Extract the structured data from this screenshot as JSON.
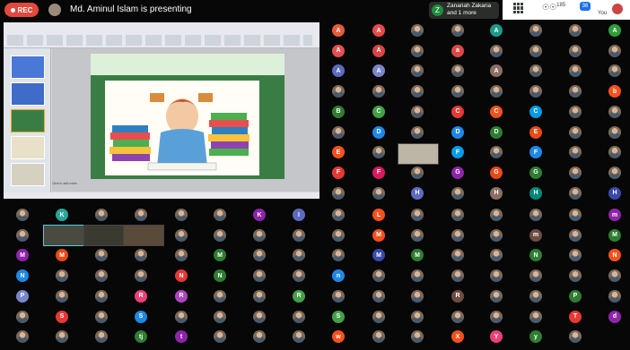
{
  "meeting": {
    "rec_label": "REC",
    "presenting_text": "Md. Aminul Islam is presenting",
    "speaker_initial": "Z",
    "speaker_line1": "Zanariah Zakaria",
    "speaker_line2": "and 1 more",
    "people_count": "185",
    "chat_count": "36",
    "you_label": "You"
  },
  "slides": {
    "notes_placeholder": "Click to add notes"
  },
  "participants": [
    {
      "row": 0,
      "col": 0,
      "initial": "A",
      "color": "#e85a3c"
    },
    {
      "row": 0,
      "col": 1,
      "initial": "A",
      "color": "#e64a4a"
    },
    {
      "row": 0,
      "col": 2,
      "initial": "",
      "color": "photo"
    },
    {
      "row": 0,
      "col": 3,
      "initial": "",
      "color": "photo"
    },
    {
      "row": 0,
      "col": 4,
      "initial": "A",
      "color": "#1b9a8a"
    },
    {
      "row": 0,
      "col": 5,
      "initial": "",
      "color": "photo"
    },
    {
      "row": 0,
      "col": 6,
      "initial": "",
      "color": "photo"
    },
    {
      "row": 0,
      "col": 7,
      "initial": "A",
      "color": "#2e9e3a"
    },
    {
      "row": 1,
      "col": 0,
      "initial": "A",
      "color": "#e05050"
    },
    {
      "row": 1,
      "col": 1,
      "initial": "A",
      "color": "#d84545"
    },
    {
      "row": 1,
      "col": 2,
      "initial": "",
      "color": "photo"
    },
    {
      "row": 1,
      "col": 3,
      "initial": "a",
      "color": "#d84a4a"
    },
    {
      "row": 1,
      "col": 4,
      "initial": "",
      "color": "photo"
    },
    {
      "row": 1,
      "col": 5,
      "initial": "",
      "color": "photo"
    },
    {
      "row": 1,
      "col": 6,
      "initial": "",
      "color": "photo"
    },
    {
      "row": 1,
      "col": 7,
      "initial": "",
      "color": "photo"
    },
    {
      "row": 2,
      "col": 0,
      "initial": "A",
      "color": "#5c6bc0"
    },
    {
      "row": 2,
      "col": 1,
      "initial": "A",
      "color": "#7986cb"
    },
    {
      "row": 2,
      "col": 2,
      "initial": "",
      "color": "photo"
    },
    {
      "row": 2,
      "col": 3,
      "initial": "",
      "color": "photo"
    },
    {
      "row": 2,
      "col": 4,
      "initial": "A",
      "color": "#8d6e63"
    },
    {
      "row": 2,
      "col": 5,
      "initial": "",
      "color": "photo"
    },
    {
      "row": 2,
      "col": 6,
      "initial": "",
      "color": "photo"
    },
    {
      "row": 2,
      "col": 7,
      "initial": "",
      "color": "photo"
    },
    {
      "row": 3,
      "col": 0,
      "initial": "",
      "color": "photo"
    },
    {
      "row": 3,
      "col": 1,
      "initial": "",
      "color": "photo"
    },
    {
      "row": 3,
      "col": 2,
      "initial": "",
      "color": "photo"
    },
    {
      "row": 3,
      "col": 3,
      "initial": "",
      "color": "photo"
    },
    {
      "row": 3,
      "col": 4,
      "initial": "",
      "color": "photo"
    },
    {
      "row": 3,
      "col": 5,
      "initial": "",
      "color": "photo"
    },
    {
      "row": 3,
      "col": 6,
      "initial": "",
      "color": "photo"
    },
    {
      "row": 3,
      "col": 7,
      "initial": "b",
      "color": "#f4511e"
    },
    {
      "row": 4,
      "col": 0,
      "initial": "B",
      "color": "#2e7d32"
    },
    {
      "row": 4,
      "col": 1,
      "initial": "C",
      "color": "#43a047"
    },
    {
      "row": 4,
      "col": 2,
      "initial": "",
      "color": "photo"
    },
    {
      "row": 4,
      "col": 3,
      "initial": "C",
      "color": "#e53935"
    },
    {
      "row": 4,
      "col": 4,
      "initial": "C",
      "color": "#f4511e"
    },
    {
      "row": 4,
      "col": 5,
      "initial": "C",
      "color": "#039be5"
    },
    {
      "row": 4,
      "col": 6,
      "initial": "",
      "color": "photo"
    },
    {
      "row": 4,
      "col": 7,
      "initial": "",
      "color": "photo"
    },
    {
      "row": 5,
      "col": 0,
      "initial": "",
      "color": "photo"
    },
    {
      "row": 5,
      "col": 1,
      "initial": "D",
      "color": "#1e88e5"
    },
    {
      "row": 5,
      "col": 2,
      "initial": "",
      "color": "photo"
    },
    {
      "row": 5,
      "col": 3,
      "initial": "D",
      "color": "#1e88e5"
    },
    {
      "row": 5,
      "col": 4,
      "initial": "D",
      "color": "#2e7d32"
    },
    {
      "row": 5,
      "col": 5,
      "initial": "E",
      "color": "#e64a19"
    },
    {
      "row": 5,
      "col": 6,
      "initial": "",
      "color": "photo"
    },
    {
      "row": 5,
      "col": 7,
      "initial": "",
      "color": "photo"
    },
    {
      "row": 6,
      "col": 0,
      "initial": "E",
      "color": "#f4511e"
    },
    {
      "row": 6,
      "col": 1,
      "initial": "",
      "color": "photo"
    },
    {
      "row": 6,
      "col": 3,
      "initial": "F",
      "color": "#039be5"
    },
    {
      "row": 6,
      "col": 4,
      "initial": "",
      "color": "photo"
    },
    {
      "row": 6,
      "col": 5,
      "initial": "F",
      "color": "#1e88e5"
    },
    {
      "row": 6,
      "col": 6,
      "initial": "",
      "color": "photo"
    },
    {
      "row": 6,
      "col": 7,
      "initial": "",
      "color": "photo"
    },
    {
      "row": 7,
      "col": 0,
      "initial": "F",
      "color": "#e53935"
    },
    {
      "row": 7,
      "col": 1,
      "initial": "F",
      "color": "#d81b60"
    },
    {
      "row": 7,
      "col": 2,
      "initial": "",
      "color": "photo"
    },
    {
      "row": 7,
      "col": 3,
      "initial": "G",
      "color": "#8e24aa"
    },
    {
      "row": 7,
      "col": 4,
      "initial": "G",
      "color": "#e64a19"
    },
    {
      "row": 7,
      "col": 5,
      "initial": "G",
      "color": "#2e7d32"
    },
    {
      "row": 7,
      "col": 6,
      "initial": "",
      "color": "photo"
    },
    {
      "row": 7,
      "col": 7,
      "initial": "",
      "color": "photo"
    },
    {
      "row": 8,
      "col": 0,
      "initial": "",
      "color": "photo"
    },
    {
      "row": 8,
      "col": 1,
      "initial": "",
      "color": "photo"
    },
    {
      "row": 8,
      "col": 2,
      "initial": "H",
      "color": "#5c6bc0"
    },
    {
      "row": 8,
      "col": 3,
      "initial": "",
      "color": "photo"
    },
    {
      "row": 8,
      "col": 4,
      "initial": "H",
      "color": "#8d6e63"
    },
    {
      "row": 8,
      "col": 5,
      "initial": "H",
      "color": "#00897b"
    },
    {
      "row": 8,
      "col": 6,
      "initial": "",
      "color": "photo"
    },
    {
      "row": 8,
      "col": 7,
      "initial": "H",
      "color": "#3949ab"
    },
    {
      "row": 9,
      "col": 0,
      "initial": "",
      "color": "photo"
    },
    {
      "row": 9,
      "col": 1,
      "initial": "K",
      "color": "#26a69a"
    },
    {
      "row": 9,
      "col": 2,
      "initial": "",
      "color": "photo"
    },
    {
      "row": 9,
      "col": 3,
      "initial": "",
      "color": "photo"
    },
    {
      "row": 9,
      "col": 4,
      "initial": "",
      "color": "photo"
    },
    {
      "row": 9,
      "col": 5,
      "initial": "",
      "color": "photo"
    },
    {
      "row": 9,
      "col": 6,
      "initial": "K",
      "color": "#8e24aa"
    },
    {
      "row": 9,
      "col": 7,
      "initial": "I",
      "color": "#5c6bc0"
    },
    {
      "row": 9,
      "col": 8,
      "initial": "",
      "color": "photo"
    },
    {
      "row": 9,
      "col": 9,
      "initial": "L",
      "color": "#f4511e"
    },
    {
      "row": 9,
      "col": 10,
      "initial": "",
      "color": "photo"
    },
    {
      "row": 9,
      "col": 11,
      "initial": "",
      "color": "photo"
    },
    {
      "row": 9,
      "col": 12,
      "initial": "",
      "color": "photo"
    },
    {
      "row": 9,
      "col": 13,
      "initial": "",
      "color": "photo"
    },
    {
      "row": 9,
      "col": 14,
      "initial": "",
      "color": "photo"
    },
    {
      "row": 9,
      "col": 15,
      "initial": "m",
      "color": "#8e24aa"
    },
    {
      "row": 10,
      "col": 0,
      "initial": "",
      "color": "photo"
    },
    {
      "row": 10,
      "col": 4,
      "initial": "",
      "color": "photo"
    },
    {
      "row": 10,
      "col": 5,
      "initial": "",
      "color": "photo"
    },
    {
      "row": 10,
      "col": 6,
      "initial": "",
      "color": "photo"
    },
    {
      "row": 10,
      "col": 7,
      "initial": "",
      "color": "photo"
    },
    {
      "row": 10,
      "col": 8,
      "initial": "",
      "color": "photo"
    },
    {
      "row": 10,
      "col": 9,
      "initial": "M",
      "color": "#f4511e"
    },
    {
      "row": 10,
      "col": 10,
      "initial": "",
      "color": "photo"
    },
    {
      "row": 10,
      "col": 11,
      "initial": "",
      "color": "photo"
    },
    {
      "row": 10,
      "col": 12,
      "initial": "",
      "color": "photo"
    },
    {
      "row": 10,
      "col": 13,
      "initial": "m",
      "color": "#6d4c41"
    },
    {
      "row": 10,
      "col": 14,
      "initial": "",
      "color": "photo"
    },
    {
      "row": 10,
      "col": 15,
      "initial": "M",
      "color": "#2e7d32"
    },
    {
      "row": 11,
      "col": 0,
      "initial": "M",
      "color": "#8e24aa"
    },
    {
      "row": 11,
      "col": 1,
      "initial": "M",
      "color": "#e64a19"
    },
    {
      "row": 11,
      "col": 2,
      "initial": "",
      "color": "photo"
    },
    {
      "row": 11,
      "col": 3,
      "initial": "",
      "color": "photo"
    },
    {
      "row": 11,
      "col": 4,
      "initial": "",
      "color": "photo"
    },
    {
      "row": 11,
      "col": 5,
      "initial": "M",
      "color": "#2e7d32"
    },
    {
      "row": 11,
      "col": 6,
      "initial": "",
      "color": "photo"
    },
    {
      "row": 11,
      "col": 7,
      "initial": "",
      "color": "photo"
    },
    {
      "row": 11,
      "col": 8,
      "initial": "",
      "color": "photo"
    },
    {
      "row": 11,
      "col": 9,
      "initial": "M",
      "color": "#3949ab"
    },
    {
      "row": 11,
      "col": 10,
      "initial": "M",
      "color": "#2e7d32"
    },
    {
      "row": 11,
      "col": 11,
      "initial": "",
      "color": "photo"
    },
    {
      "row": 11,
      "col": 12,
      "initial": "",
      "color": "photo"
    },
    {
      "row": 11,
      "col": 13,
      "initial": "N",
      "color": "#2e7d32"
    },
    {
      "row": 11,
      "col": 14,
      "initial": "",
      "color": "photo"
    },
    {
      "row": 11,
      "col": 15,
      "initial": "N",
      "color": "#f4511e"
    },
    {
      "row": 12,
      "col": 0,
      "initial": "N",
      "color": "#1e88e5"
    },
    {
      "row": 12,
      "col": 1,
      "initial": "",
      "color": "photo"
    },
    {
      "row": 12,
      "col": 2,
      "initial": "",
      "color": "photo"
    },
    {
      "row": 12,
      "col": 3,
      "initial": "",
      "color": "photo"
    },
    {
      "row": 12,
      "col": 4,
      "initial": "N",
      "color": "#e53935"
    },
    {
      "row": 12,
      "col": 5,
      "initial": "N",
      "color": "#2e7d32"
    },
    {
      "row": 12,
      "col": 6,
      "initial": "",
      "color": "photo"
    },
    {
      "row": 12,
      "col": 7,
      "initial": "",
      "color": "photo"
    },
    {
      "row": 12,
      "col": 8,
      "initial": "n",
      "color": "#1e88e5"
    },
    {
      "row": 12,
      "col": 9,
      "initial": "",
      "color": "photo"
    },
    {
      "row": 12,
      "col": 10,
      "initial": "",
      "color": "photo"
    },
    {
      "row": 12,
      "col": 11,
      "initial": "",
      "color": "photo"
    },
    {
      "row": 12,
      "col": 12,
      "initial": "",
      "color": "photo"
    },
    {
      "row": 12,
      "col": 13,
      "initial": "",
      "color": "photo"
    },
    {
      "row": 12,
      "col": 14,
      "initial": "",
      "color": "photo"
    },
    {
      "row": 12,
      "col": 15,
      "initial": "",
      "color": "photo"
    },
    {
      "row": 13,
      "col": 0,
      "initial": "P",
      "color": "#7986cb"
    },
    {
      "row": 13,
      "col": 1,
      "initial": "",
      "color": "photo"
    },
    {
      "row": 13,
      "col": 2,
      "initial": "",
      "color": "photo"
    },
    {
      "row": 13,
      "col": 3,
      "initial": "R",
      "color": "#ec407a"
    },
    {
      "row": 13,
      "col": 4,
      "initial": "R",
      "color": "#ab47bc"
    },
    {
      "row": 13,
      "col": 5,
      "initial": "",
      "color": "photo"
    },
    {
      "row": 13,
      "col": 6,
      "initial": "",
      "color": "photo"
    },
    {
      "row": 13,
      "col": 7,
      "initial": "R",
      "color": "#43a047"
    },
    {
      "row": 13,
      "col": 8,
      "initial": "",
      "color": "photo"
    },
    {
      "row": 13,
      "col": 9,
      "initial": "",
      "color": "photo"
    },
    {
      "row": 13,
      "col": 10,
      "initial": "",
      "color": "photo"
    },
    {
      "row": 13,
      "col": 11,
      "initial": "R",
      "color": "#6d4c41"
    },
    {
      "row": 13,
      "col": 12,
      "initial": "",
      "color": "photo"
    },
    {
      "row": 13,
      "col": 13,
      "initial": "",
      "color": "photo"
    },
    {
      "row": 13,
      "col": 14,
      "initial": "P",
      "color": "#2e7d32"
    },
    {
      "row": 13,
      "col": 15,
      "initial": "",
      "color": "photo"
    },
    {
      "row": 14,
      "col": 0,
      "initial": "",
      "color": "photo"
    },
    {
      "row": 14,
      "col": 1,
      "initial": "S",
      "color": "#e53935"
    },
    {
      "row": 14,
      "col": 2,
      "initial": "",
      "color": "photo"
    },
    {
      "row": 14,
      "col": 3,
      "initial": "S",
      "color": "#1e88e5"
    },
    {
      "row": 14,
      "col": 4,
      "initial": "",
      "color": "photo"
    },
    {
      "row": 14,
      "col": 5,
      "initial": "",
      "color": "photo"
    },
    {
      "row": 14,
      "col": 6,
      "initial": "",
      "color": "photo"
    },
    {
      "row": 14,
      "col": 7,
      "initial": "",
      "color": "photo"
    },
    {
      "row": 14,
      "col": 8,
      "initial": "S",
      "color": "#43a047"
    },
    {
      "row": 14,
      "col": 9,
      "initial": "",
      "color": "photo"
    },
    {
      "row": 14,
      "col": 10,
      "initial": "",
      "color": "photo"
    },
    {
      "row": 14,
      "col": 11,
      "initial": "",
      "color": "photo"
    },
    {
      "row": 14,
      "col": 12,
      "initial": "",
      "color": "photo"
    },
    {
      "row": 14,
      "col": 13,
      "initial": "",
      "color": "photo"
    },
    {
      "row": 14,
      "col": 14,
      "initial": "T",
      "color": "#e53935"
    },
    {
      "row": 14,
      "col": 15,
      "initial": "d",
      "color": "#8e24aa"
    },
    {
      "row": 15,
      "col": 0,
      "initial": "",
      "color": "photo"
    },
    {
      "row": 15,
      "col": 1,
      "initial": "",
      "color": "photo"
    },
    {
      "row": 15,
      "col": 2,
      "initial": "",
      "color": "photo"
    },
    {
      "row": 15,
      "col": 3,
      "initial": "tj",
      "color": "#2e7d32"
    },
    {
      "row": 15,
      "col": 4,
      "initial": "t",
      "color": "#8e24aa"
    },
    {
      "row": 15,
      "col": 5,
      "initial": "",
      "color": "photo"
    },
    {
      "row": 15,
      "col": 6,
      "initial": "",
      "color": "photo"
    },
    {
      "row": 15,
      "col": 7,
      "initial": "",
      "color": "photo"
    },
    {
      "row": 15,
      "col": 8,
      "initial": "w",
      "color": "#f4511e"
    },
    {
      "row": 15,
      "col": 9,
      "initial": "",
      "color": "photo"
    },
    {
      "row": 15,
      "col": 10,
      "initial": "",
      "color": "photo"
    },
    {
      "row": 15,
      "col": 11,
      "initial": "X",
      "color": "#f4511e"
    },
    {
      "row": 15,
      "col": 12,
      "initial": "Y",
      "color": "#ec407a"
    },
    {
      "row": 15,
      "col": 13,
      "initial": "y",
      "color": "#2e7d32"
    },
    {
      "row": 15,
      "col": 14,
      "initial": "",
      "color": "photo"
    }
  ]
}
